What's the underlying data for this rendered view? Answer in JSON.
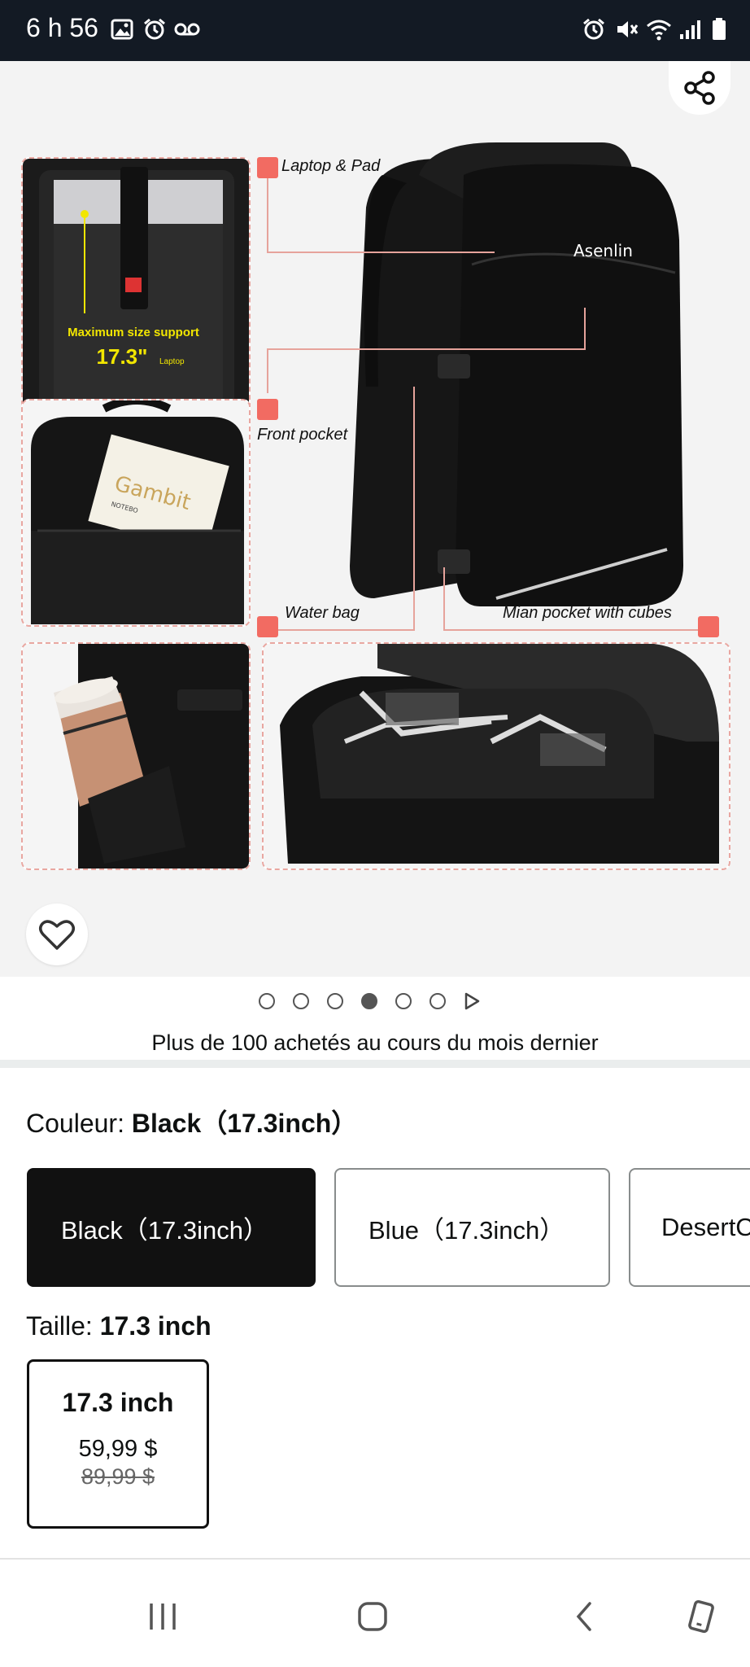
{
  "status_bar": {
    "time": "6 h 56",
    "icons_left": [
      "image-icon",
      "alarm-icon",
      "voicemail-icon"
    ],
    "icons_right": [
      "alarm-icon",
      "mute-icon",
      "wifi-icon",
      "signal-icon",
      "battery-icon"
    ]
  },
  "gallery": {
    "brand": "Asenlin",
    "callouts": {
      "laptop": "Laptop & Pad",
      "front": "Front pocket",
      "water": "Water bag",
      "main": "Mian pocket with cubes"
    },
    "laptop_caption": "Maximum size support",
    "laptop_size": "17.3\"",
    "laptop_size_unit": "Laptop",
    "notebook_text": "Gambit",
    "notebook_sub": "NOTEBO",
    "dots_total": 6,
    "dots_active_index": 3
  },
  "social_proof": "Plus de 100 achetés au cours du mois dernier",
  "color": {
    "label": "Couleur: ",
    "value": "Black（17.3inch）",
    "options": [
      "Black（17.3inch）",
      "Blue（17.3inch）",
      "DesertC"
    ],
    "selected_index": 0
  },
  "size": {
    "label": "Taille: ",
    "value": "17.3 inch",
    "options": [
      {
        "name": "17.3 inch",
        "price": "59,99 $",
        "old_price": "89,99 $"
      }
    ]
  },
  "colors": {
    "accent": "#f26b62",
    "status_bar_bg": "#131a24",
    "selected_swatch": "#111111"
  }
}
